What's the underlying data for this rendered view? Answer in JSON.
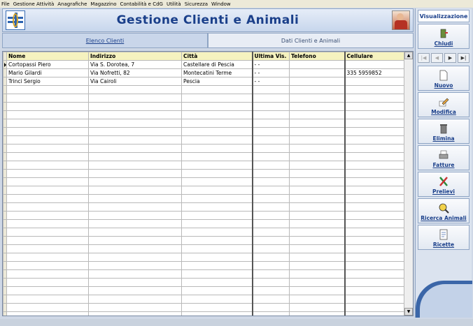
{
  "menu": [
    "File",
    "Gestione Attività",
    "Anagrafiche",
    "Magazzino",
    "Contabilità e CdG",
    "Utilità",
    "Sicurezza",
    "Window"
  ],
  "header": {
    "title": "Gestione Clienti e Animali"
  },
  "tabs": [
    {
      "label": "Elenco Clienti",
      "active": true
    },
    {
      "label": "Dati Clienti e Animali",
      "active": false
    }
  ],
  "grid": {
    "columns": [
      "Nome",
      "Indirizzo",
      "Città",
      "Ultima Vis.",
      "Telefono",
      "Cellulare"
    ],
    "rows": [
      {
        "nome": "Cortopassi Piero",
        "indirizzo": "Via S. Dorotea, 7",
        "citta": "Castellare di Pescia",
        "ultima": "- -",
        "telefono": "",
        "cellulare": ""
      },
      {
        "nome": "Mario Gilardi",
        "indirizzo": "Via Nofretti, 82",
        "citta": "Montecatini Terme",
        "ultima": "- -",
        "telefono": "",
        "cellulare": "335 5959852"
      },
      {
        "nome": "Trinci Sergio",
        "indirizzo": "Via Cairoli",
        "citta": "Pescia",
        "ultima": "- -",
        "telefono": "",
        "cellulare": ""
      }
    ]
  },
  "panel": {
    "mode": "Visualizzazione",
    "nav": [
      "|◀",
      "◀",
      "▶",
      "▶|"
    ],
    "buttons": [
      {
        "label": "Chiudi",
        "icon": "door-exit-icon"
      },
      {
        "label": "Nuovo",
        "icon": "new-document-icon"
      },
      {
        "label": "Modifica",
        "icon": "edit-pencil-icon"
      },
      {
        "label": "Elimina",
        "icon": "trash-icon"
      },
      {
        "label": "Fatture",
        "icon": "printer-icon"
      },
      {
        "label": "Prelievi",
        "icon": "lab-tools-icon"
      },
      {
        "label": "Ricerca Animali",
        "icon": "search-animals-icon"
      },
      {
        "label": "Ricette",
        "icon": "prescription-icon"
      }
    ]
  }
}
